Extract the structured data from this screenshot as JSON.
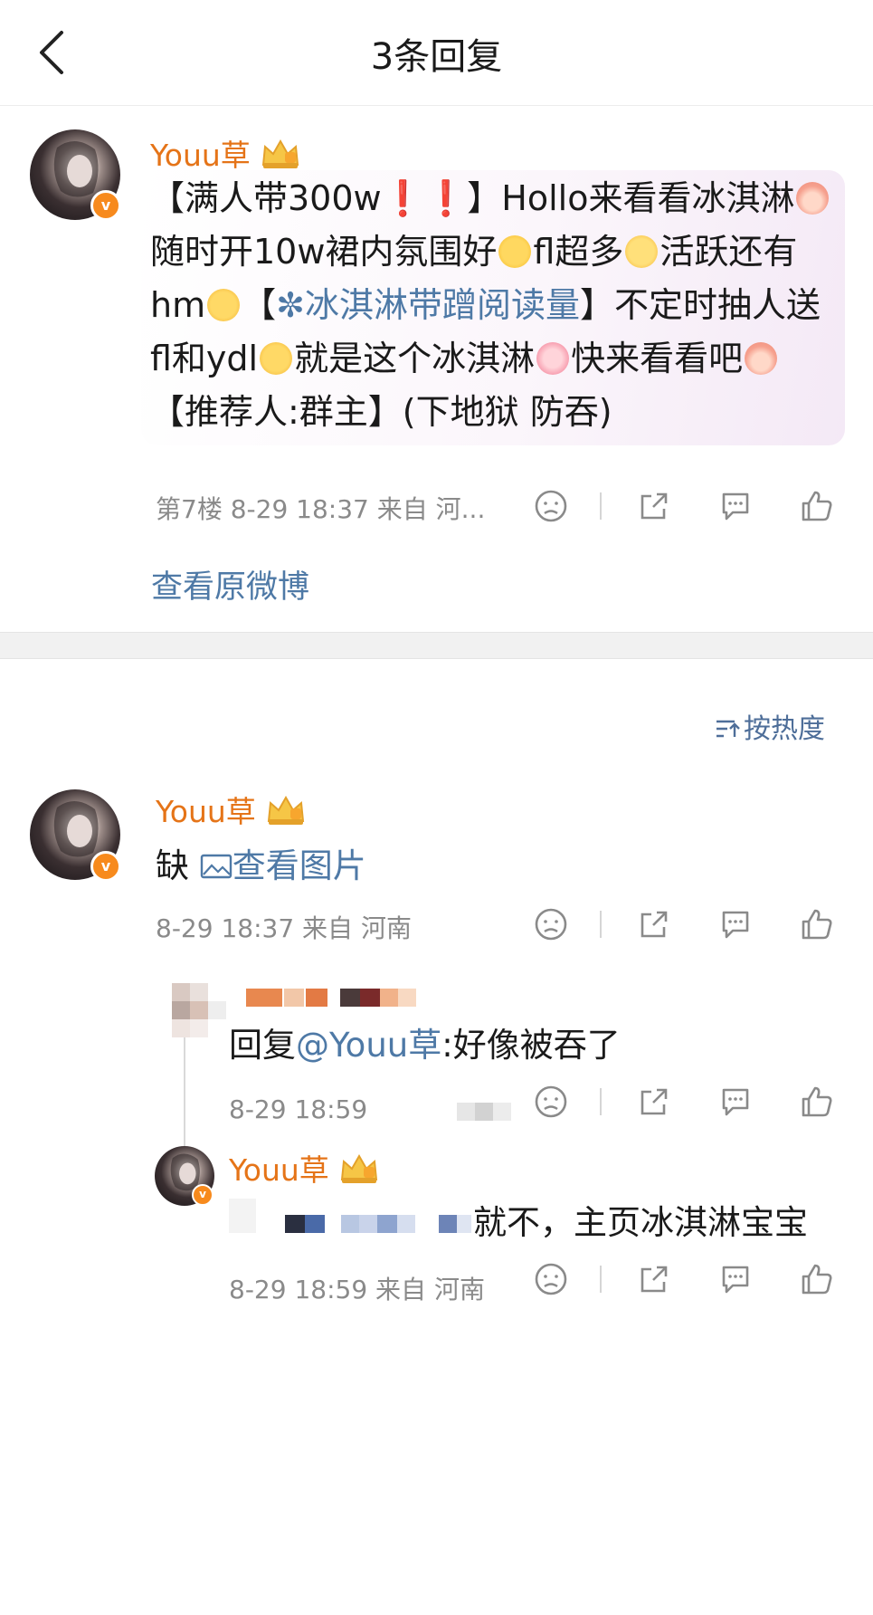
{
  "header": {
    "title": "3条回复"
  },
  "post": {
    "author": "Youu草",
    "text_parts": [
      "【满人带300w",
      "❗",
      "❗",
      "】Hollo来看看冰淇淋",
      "随时开10w裙内氛围好",
      "fl超多",
      "活跃还有hm",
      "【",
      "✼冰淇淋带蹭阅读量",
      "】不定时抽人送fl和ydl",
      "就是这个冰淇淋",
      "快来看看吧",
      "【推荐人:群主】(下地狱 防吞)"
    ],
    "meta": "第7楼  8-29 18:37  来自 河...",
    "view_original": "查看原微博"
  },
  "sort": {
    "label": "按热度"
  },
  "comments": [
    {
      "author": "Youu草",
      "text": "缺",
      "image_link": "查看图片",
      "meta": "8-29 18:37  来自 河南"
    }
  ],
  "replies": [
    {
      "prefix": "回复",
      "mention": "@Youu草",
      "text": ":好像被吞了",
      "meta": "8-29 18:59"
    },
    {
      "author": "Youu草",
      "text": "就不，主页冰淇淋宝宝",
      "meta": "8-29 18:59  来自 河南"
    }
  ],
  "colors": {
    "accent_orange": "#e57418",
    "link_blue": "#4e79a6",
    "meta_gray": "#8a8a8a"
  }
}
